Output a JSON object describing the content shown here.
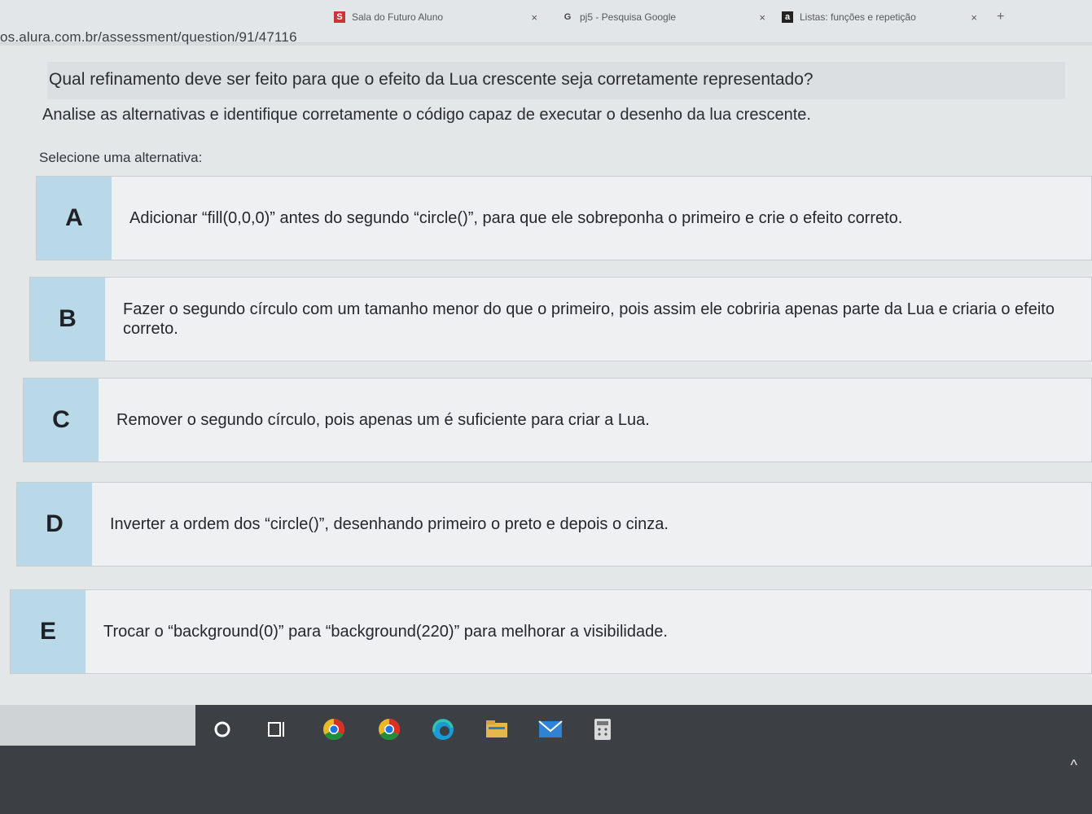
{
  "browser": {
    "tabs": [
      {
        "label": "Sala do Futuro Aluno",
        "close": "×"
      },
      {
        "label": "pj5 - Pesquisa Google",
        "close": "×"
      },
      {
        "label": "Listas: funções e repetição",
        "close": "×"
      }
    ],
    "new_tab": "+",
    "url": "os.alura.com.br/assessment/question/91/47116"
  },
  "question": {
    "title": "Qual refinamento deve ser feito para que o efeito da Lua crescente seja corretamente representado?",
    "instruction": "Analise as alternativas e identifique corretamente o código capaz de executar o desenho da lua crescente.",
    "select_label": "Selecione uma alternativa:"
  },
  "options": [
    {
      "letter": "A",
      "text": "Adicionar “fill(0,0,0)” antes do segundo “circle()”, para que ele sobreponha o primeiro e crie o efeito correto."
    },
    {
      "letter": "B",
      "text": "Fazer o segundo círculo com um tamanho menor do que o primeiro, pois assim ele cobriria apenas parte da Lua e criaria o efeito correto."
    },
    {
      "letter": "C",
      "text": "Remover o segundo círculo, pois apenas um é suficiente para criar a Lua."
    },
    {
      "letter": "D",
      "text": "Inverter a ordem dos “circle()”, desenhando primeiro o preto e depois o cinza."
    },
    {
      "letter": "E",
      "text": "Trocar o “background(0)” para “background(220)” para melhorar a visibilidade."
    }
  ],
  "taskbar": {
    "icons": [
      "cortana-icon",
      "task-view-icon",
      "chrome-icon",
      "chrome-icon",
      "edge-icon",
      "file-explorer-icon",
      "mail-icon",
      "calculator-icon"
    ],
    "chevron": "^"
  }
}
